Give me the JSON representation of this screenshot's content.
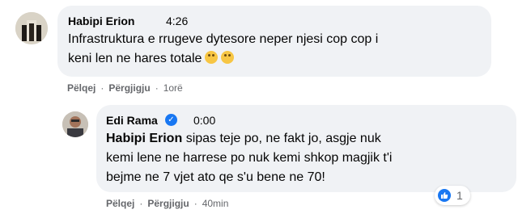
{
  "comments": [
    {
      "author": "Habipi Erion",
      "time": "4:26",
      "text_line1": "Infrastruktura e rrugeve dytesore neper njesi cop cop i",
      "text_line2": "keni len ne hares totale",
      "emojis": [
        "upside-down-face",
        "upside-down-face"
      ],
      "actions": {
        "like": "Pëlqej",
        "reply": "Përgjigju",
        "age": "1orë"
      }
    },
    {
      "author": "Edi Rama",
      "verified": true,
      "time": "0:00",
      "mention": "Habipi Erion",
      "text_line1": "sipas teje po, ne fakt jo, asgje nuk",
      "text_line2": "kemi lene ne harrese po nuk kemi shkop magjik t'i",
      "text_line3": "bejme ne 7 vjet ato qe s'u bene ne 70!",
      "actions": {
        "like": "Pëlqej",
        "reply": "Përgjigju",
        "age": "40min"
      },
      "reactions": {
        "type": "like",
        "count": "1"
      }
    }
  ],
  "colors": {
    "bubble": "#f0f2f5",
    "accent": "#1877f2",
    "secondary_text": "#65676b"
  }
}
